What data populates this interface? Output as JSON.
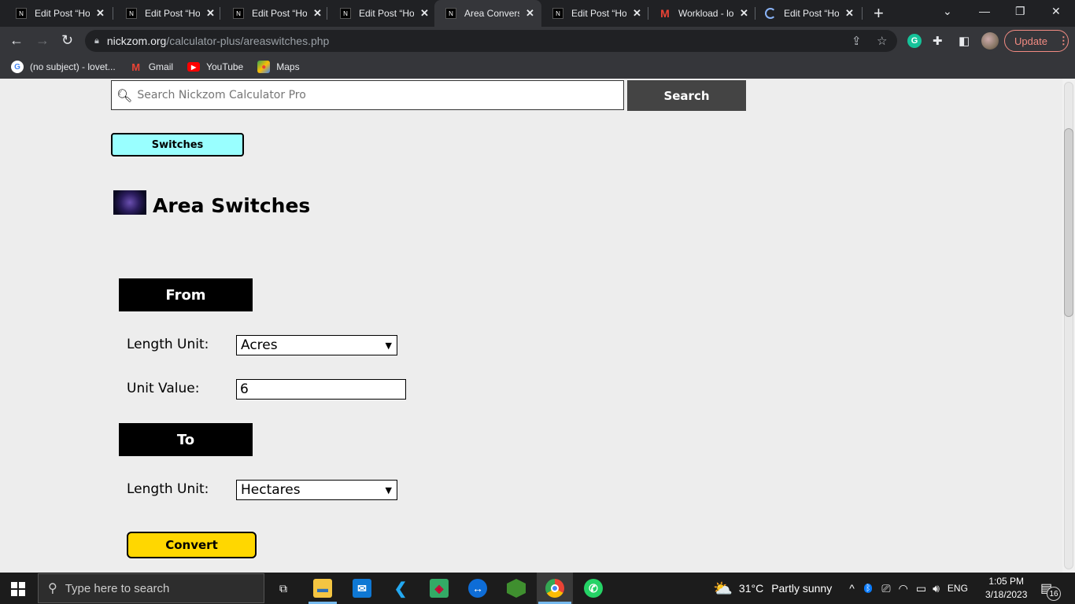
{
  "browser": {
    "tabs": [
      {
        "title": "Edit Post “How",
        "icon": "nickzom-favicon",
        "active": false
      },
      {
        "title": "Edit Post “How",
        "icon": "nickzom-favicon",
        "active": false
      },
      {
        "title": "Edit Post “How",
        "icon": "nickzom-favicon",
        "active": false
      },
      {
        "title": "Edit Post “How",
        "icon": "nickzom-favicon",
        "active": false
      },
      {
        "title": "Area Conversi",
        "icon": "nickzom-favicon",
        "active": true
      },
      {
        "title": "Edit Post “How",
        "icon": "nickzom-favicon",
        "active": false
      },
      {
        "title": "Workload - lo",
        "icon": "gmail-icon",
        "active": false
      },
      {
        "title": "Edit Post “How",
        "icon": "loading-spinner-icon",
        "active": false
      }
    ],
    "url_host": "nickzom.org",
    "url_path": "/calculator-plus/areaswitches.php",
    "update_label": "Update",
    "bookmarks": [
      {
        "label": "(no subject) - lovet...",
        "icon": "google-icon"
      },
      {
        "label": "Gmail",
        "icon": "gmail-icon"
      },
      {
        "label": "YouTube",
        "icon": "youtube-icon"
      },
      {
        "label": "Maps",
        "icon": "maps-icon"
      }
    ]
  },
  "page": {
    "search_placeholder": "Search Nickzom Calculator Pro",
    "search_button": "Search",
    "switches_button": "Switches",
    "title": "Area Switches",
    "from_heading": "From",
    "from_unit_label": "Length Unit:",
    "from_unit_value": "Acres",
    "unit_value_label": "Unit Value:",
    "unit_value": "6",
    "to_heading": "To",
    "to_unit_label": "Length Unit:",
    "to_unit_value": "Hectares",
    "convert_button": "Convert"
  },
  "taskbar": {
    "search_placeholder": "Type here to search",
    "weather_temp": "31°C",
    "weather_desc": "Partly sunny",
    "language": "ENG",
    "time": "1:05 PM",
    "date": "3/18/2023",
    "notification_count": "16"
  }
}
